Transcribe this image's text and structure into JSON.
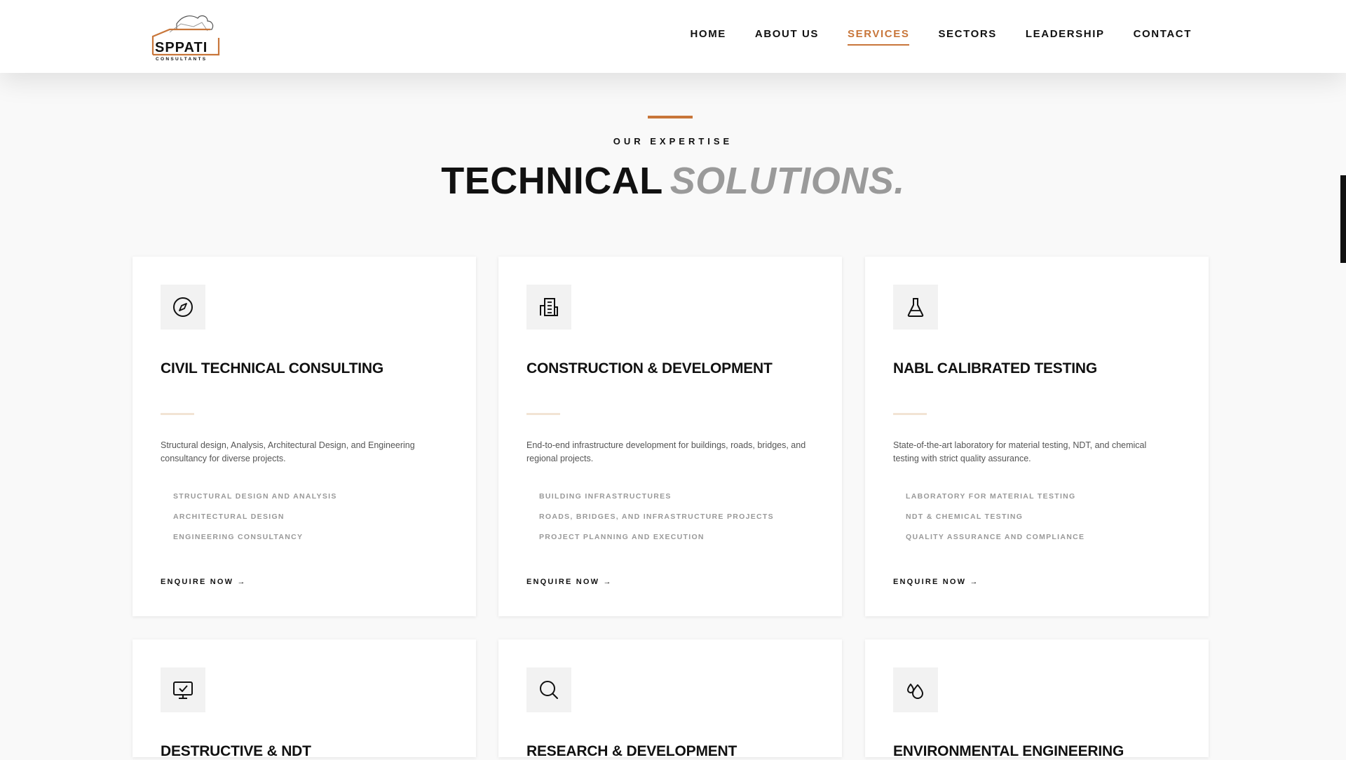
{
  "brand": {
    "name": "SPPATI",
    "tagline": "CONSULTANTS",
    "accent": "#c8763a"
  },
  "nav": [
    {
      "label": "HOME",
      "active": false
    },
    {
      "label": "ABOUT US",
      "active": false
    },
    {
      "label": "SERVICES",
      "active": true
    },
    {
      "label": "SECTORS",
      "active": false
    },
    {
      "label": "LEADERSHIP",
      "active": false
    },
    {
      "label": "CONTACT",
      "active": false
    }
  ],
  "section": {
    "eyebrow": "OUR EXPERTISE",
    "title_part1": "TECHNICAL",
    "title_part2": "SOLUTIONS."
  },
  "services": [
    {
      "icon": "compass-icon",
      "title": "CIVIL TECHNICAL CONSULTING",
      "description": "Structural design, Analysis, Architectural Design, and Engineering consultancy for diverse projects.",
      "features": [
        "STRUCTURAL DESIGN AND ANALYSIS",
        "ARCHITECTURAL DESIGN",
        "ENGINEERING CONSULTANCY"
      ],
      "cta": "ENQUIRE NOW →"
    },
    {
      "icon": "building-icon",
      "title": "CONSTRUCTION & DEVELOPMENT",
      "description": "End-to-end infrastructure development for buildings, roads, bridges, and regional projects.",
      "features": [
        "BUILDING INFRASTRUCTURES",
        "ROADS, BRIDGES, AND INFRASTRUCTURE PROJECTS",
        "PROJECT PLANNING AND EXECUTION"
      ],
      "cta": "ENQUIRE NOW →"
    },
    {
      "icon": "flask-icon",
      "title": "NABL CALIBRATED TESTING",
      "description": "State-of-the-art laboratory for material testing, NDT, and chemical testing with strict quality assurance.",
      "features": [
        "LABORATORY FOR MATERIAL TESTING",
        "NDT & CHEMICAL TESTING",
        "QUALITY ASSURANCE AND COMPLIANCE"
      ],
      "cta": "ENQUIRE NOW →"
    },
    {
      "icon": "monitor-check-icon",
      "title": "DESTRUCTIVE & NDT"
    },
    {
      "icon": "search-icon",
      "title": "RESEARCH & DEVELOPMENT"
    },
    {
      "icon": "droplets-icon",
      "title": "ENVIRONMENTAL ENGINEERING"
    }
  ]
}
